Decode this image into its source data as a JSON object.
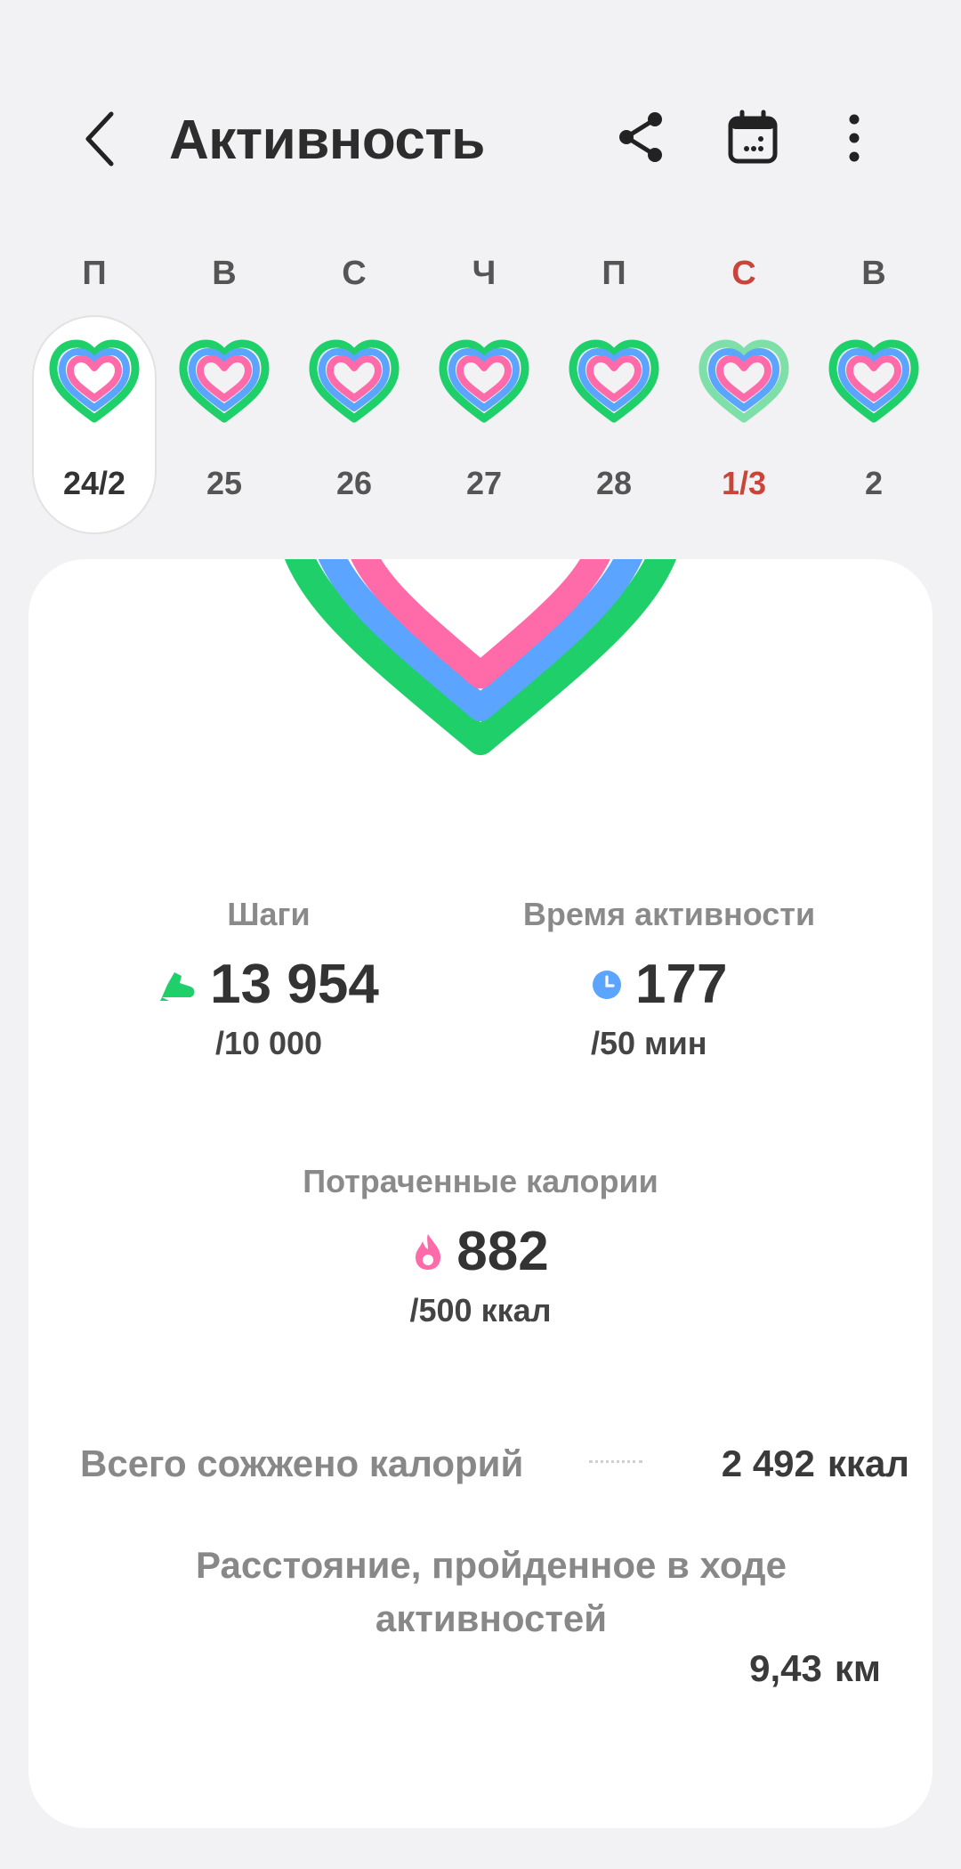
{
  "header": {
    "title": "Активность",
    "back_icon": "chevron-left-icon",
    "share_icon": "share-icon",
    "calendar_icon": "calendar-icon",
    "more_icon": "more-vertical-icon"
  },
  "week": [
    {
      "letter": "П",
      "date": "24/2",
      "selected": true,
      "weekend": false
    },
    {
      "letter": "В",
      "date": "25",
      "selected": false,
      "weekend": false
    },
    {
      "letter": "С",
      "date": "26",
      "selected": false,
      "weekend": false
    },
    {
      "letter": "Ч",
      "date": "27",
      "selected": false,
      "weekend": false
    },
    {
      "letter": "П",
      "date": "28",
      "selected": false,
      "weekend": false
    },
    {
      "letter": "С",
      "date": "1/3",
      "selected": false,
      "weekend": true
    },
    {
      "letter": "В",
      "date": "2",
      "selected": false,
      "weekend": false
    }
  ],
  "metrics": {
    "steps": {
      "label": "Шаги",
      "value": "13 954",
      "goal": "/10 000",
      "icon": "shoe-icon"
    },
    "active_time": {
      "label": "Время активности",
      "value": "177",
      "goal": "/50 мин",
      "icon": "clock-icon"
    },
    "calories": {
      "label": "Потраченные калории",
      "value": "882",
      "goal": "/500 ккал",
      "icon": "flame-icon"
    }
  },
  "totals": {
    "burned_label": "Всего сожжено калорий",
    "burned_value": "2 492",
    "burned_unit": "ккал",
    "distance_label": "Расстояние, пройденное в ходе активностей",
    "distance_value": "9,43",
    "distance_unit": "км"
  },
  "colors": {
    "steps": "#1fcf6a",
    "active_time": "#5ba4ff",
    "calories": "#ff6aa8",
    "weekend": "#c9453a"
  }
}
